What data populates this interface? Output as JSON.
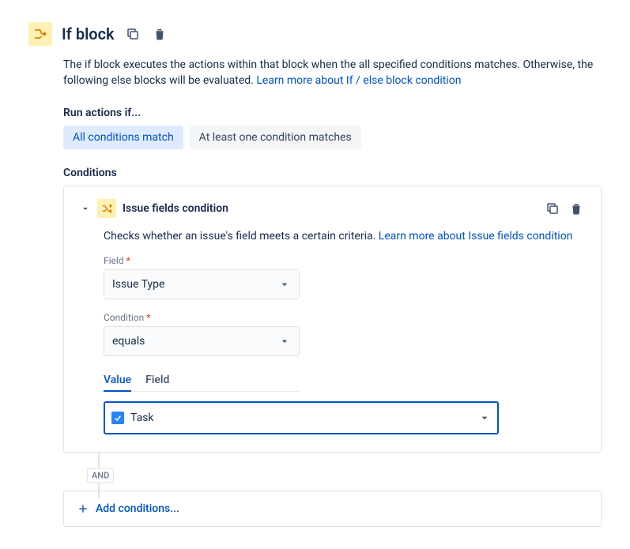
{
  "header": {
    "title": "If block"
  },
  "description": {
    "text": "The if block executes the actions within that block when the all specified conditions matches. Otherwise, the following else blocks will be evaluated. ",
    "link_text": "Learn more about If / else block condition"
  },
  "run_actions": {
    "label": "Run actions if...",
    "options": {
      "all": "All conditions match",
      "any": "At least one condition matches"
    }
  },
  "conditions": {
    "label": "Conditions",
    "item": {
      "title": "Issue fields condition",
      "desc": "Checks whether an issue's field meets a certain criteria. ",
      "link_text": "Learn more about Issue fields condition",
      "field_label": "Field",
      "field_value": "Issue Type",
      "condition_label": "Condition",
      "condition_value": "equals",
      "tabs": {
        "value": "Value",
        "field": "Field"
      },
      "selected_value": "Task"
    },
    "connector": "AND",
    "add_label": "Add conditions..."
  }
}
